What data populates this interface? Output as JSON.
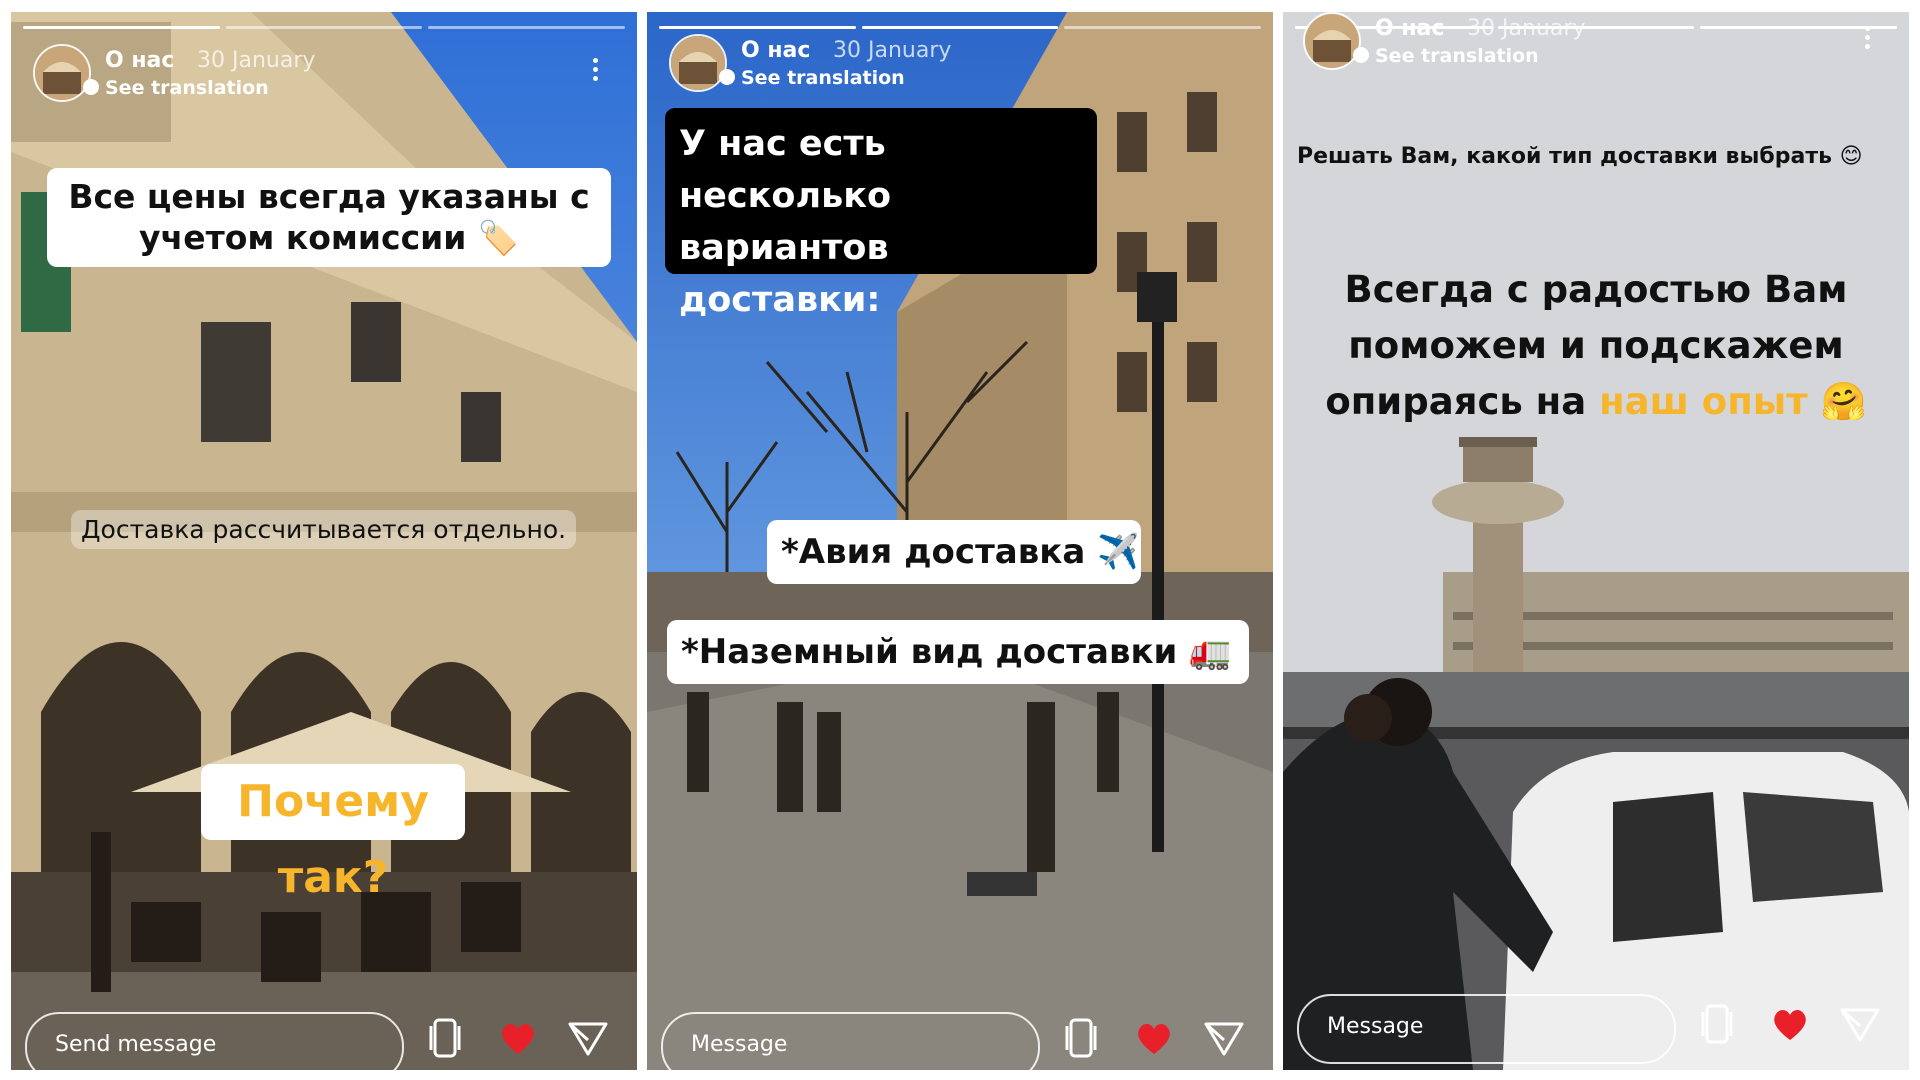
{
  "account": {
    "name": "О нас",
    "date": "30 January",
    "see_translation": "See translation"
  },
  "story1": {
    "caption_main": "Все цены всегда указаны с учетом комиссии",
    "caption_emoji": "🏷️",
    "caption_delivery": "Доставка рассчитывается отдельно.",
    "caption_why": "Почему так?",
    "message_placeholder": "Send message"
  },
  "story2": {
    "title": "У нас есть несколько вариантов доставки:",
    "option_air": "*Авия доставка",
    "option_air_emoji": "✈️",
    "option_ground": "*Наземный вид доставки",
    "option_ground_emoji": "🚛",
    "message_placeholder": "Message"
  },
  "story3": {
    "choose_text": "Решать Вам, какой тип доставки выбрать",
    "choose_emoji": "😊",
    "help_text": "Всегда с радостью Вам поможем и подскажем опираясь на",
    "help_highlight": "наш опыт",
    "help_emoji": "🤗",
    "message_placeholder": "Message"
  },
  "colors": {
    "highlight": "#f7b52c",
    "like": "#e8202a"
  }
}
